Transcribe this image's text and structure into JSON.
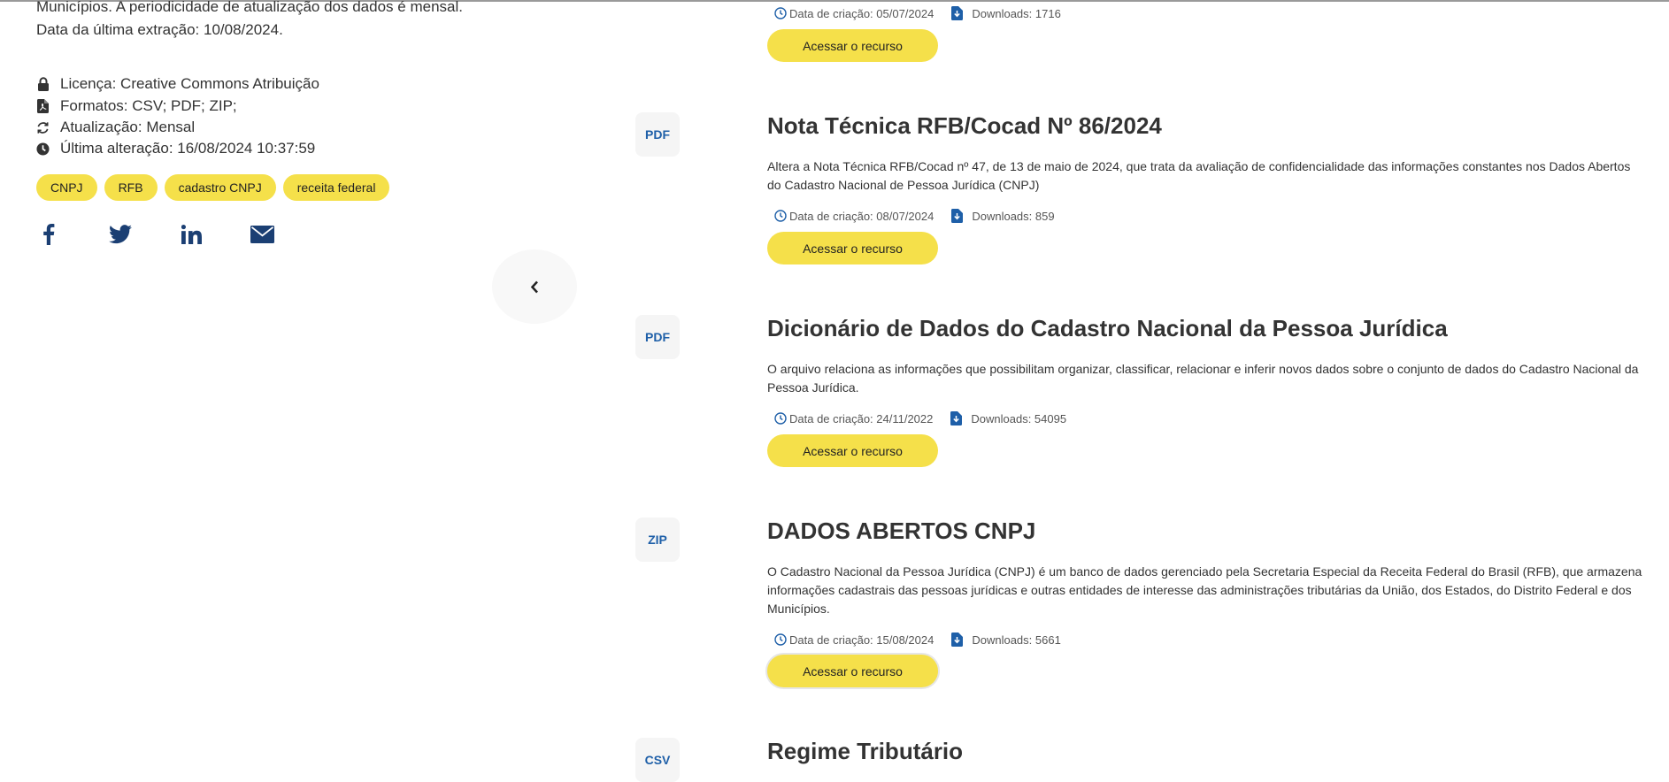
{
  "intro": {
    "line1": "Municípios. A periodicidade de atualização dos dados é mensal.",
    "line2": "Data da última extração: 10/08/2024."
  },
  "meta": {
    "license": "Licença: Creative Commons Atribuição",
    "formats": "Formatos: CSV; PDF; ZIP;",
    "update": "Atualização: Mensal",
    "last_change": "Última alteração: 16/08/2024 10:37:59"
  },
  "tags": [
    "CNPJ",
    "RFB",
    "cadastro CNPJ",
    "receita federal"
  ],
  "social": [
    "facebook-icon",
    "twitter-icon",
    "linkedin-icon",
    "email-icon"
  ],
  "colors": {
    "accent_yellow": "#f5e04a",
    "badge_blue": "#1e5fa8",
    "icon_blue": "#1e5fa8"
  },
  "resources": [
    {
      "format": "",
      "title": "",
      "description": "",
      "created": "Data de criação: 05/07/2024",
      "downloads": "Downloads: 1716",
      "button": "Acessar o recurso"
    },
    {
      "format": "PDF",
      "title": "Nota Técnica RFB/Cocad Nº 86/2024",
      "description": "Altera a Nota Técnica RFB/Cocad nº 47, de 13 de maio de 2024, que trata da avaliação de confidencialidade das informações constantes nos Dados Abertos do Cadastro Nacional de Pessoa Jurídica (CNPJ)",
      "created": "Data de criação: 08/07/2024",
      "downloads": "Downloads: 859",
      "button": "Acessar o recurso"
    },
    {
      "format": "PDF",
      "title": "Dicionário de Dados do Cadastro Nacional da Pessoa Jurídica",
      "description": "O arquivo relaciona as informações que possibilitam organizar, classificar, relacionar e inferir novos dados sobre o conjunto de dados do Cadastro Nacional da Pessoa Jurídica.",
      "created": "Data de criação: 24/11/2022",
      "downloads": "Downloads: 54095",
      "button": "Acessar o recurso"
    },
    {
      "format": "ZIP",
      "title": "DADOS ABERTOS CNPJ",
      "description": "O Cadastro Nacional da Pessoa Jurídica (CNPJ) é um banco de dados gerenciado pela Secretaria Especial da Receita Federal do Brasil (RFB), que armazena informações cadastrais das pessoas jurídicas e outras entidades de interesse das administrações tributárias da União, dos Estados, do Distrito Federal e dos Municípios.",
      "created": "Data de criação: 15/08/2024",
      "downloads": "Downloads: 5661",
      "button": "Acessar o recurso"
    },
    {
      "format": "CSV",
      "title": "Regime Tributário"
    }
  ]
}
